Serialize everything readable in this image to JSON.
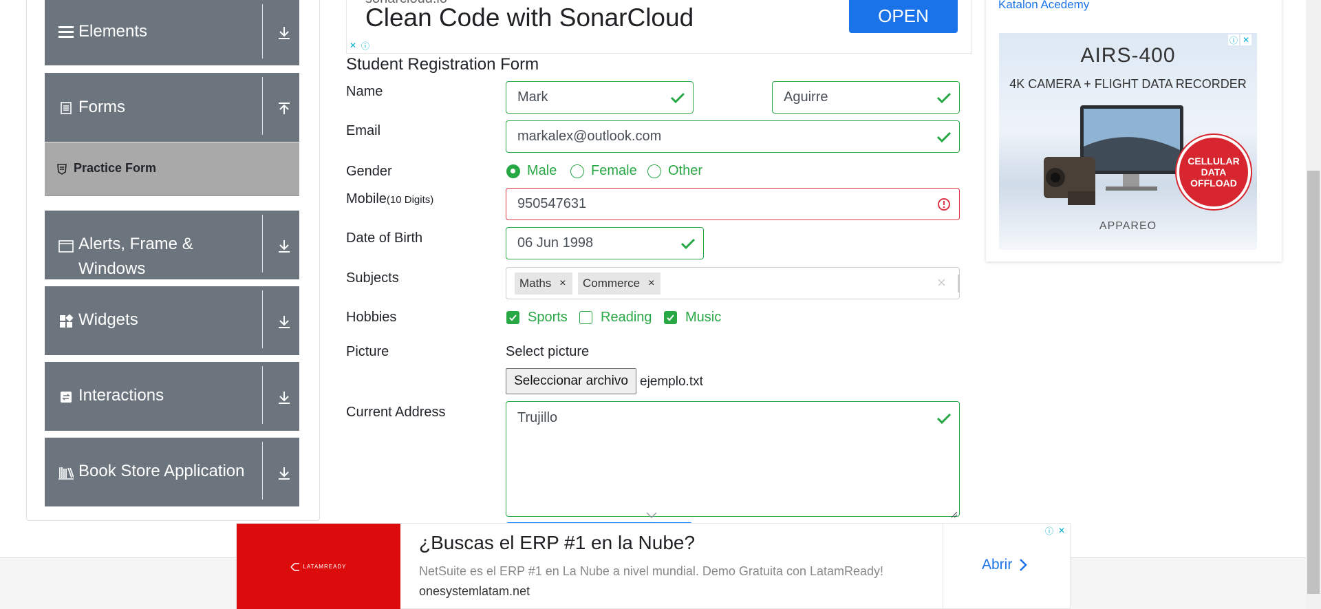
{
  "sidebar": {
    "groups": [
      {
        "label": "Elements",
        "icon": "hamburger-icon",
        "arrow": "download-arrow-icon"
      },
      {
        "label": "Forms",
        "icon": "document-icon",
        "arrow": "upload-arrow-icon"
      },
      {
        "label": "Alerts, Frame &",
        "label2": "Windows",
        "icon": "window-icon",
        "arrow": "download-arrow-icon"
      },
      {
        "label": "Widgets",
        "icon": "widgets-icon",
        "arrow": "download-arrow-icon"
      },
      {
        "label": "Interactions",
        "icon": "interactions-icon",
        "arrow": "download-arrow-icon"
      },
      {
        "label": "Book Store Application",
        "icon": "books-icon",
        "arrow": "download-arrow-icon"
      }
    ],
    "active_item": {
      "label": "Practice Form",
      "icon": "shield-icon"
    }
  },
  "top_ad": {
    "domain": "sonarcloud.io",
    "headline": "Clean Code with SonarCloud",
    "cta": "OPEN"
  },
  "form": {
    "title": "Student Registration Form",
    "name_label": "Name",
    "first_name": "Mark",
    "last_name": "Aguirre",
    "email_label": "Email",
    "email": "markalex@outlook.com",
    "gender_label": "Gender",
    "gender_options": [
      "Male",
      "Female",
      "Other"
    ],
    "gender_selected": "Male",
    "mobile_label": "Mobile",
    "mobile_hint": "(10 Digits)",
    "mobile": "950547631",
    "dob_label": "Date of Birth",
    "dob": "06 Jun 1998",
    "subjects_label": "Subjects",
    "subjects": [
      "Maths",
      "Commerce"
    ],
    "chip_remove": "×",
    "subjects_clear": "×",
    "hobbies_label": "Hobbies",
    "hobbies": [
      {
        "label": "Sports",
        "checked": true
      },
      {
        "label": "Reading",
        "checked": false
      },
      {
        "label": "Music",
        "checked": true
      }
    ],
    "picture_label": "Picture",
    "picture_prompt": "Select picture",
    "file_button": "Seleccionar archivo",
    "file_name": "ejemplo.txt",
    "address_label": "Current Address",
    "address": "Trujillo"
  },
  "right_ad": {
    "link_text": "Katalon Acedemy",
    "headline": "AIRS-400",
    "subheadline": "4K CAMERA + FLIGHT DATA RECORDER",
    "badge": "CELLULAR DATA OFFLOAD",
    "brand": "APPAREO"
  },
  "bottom_ad": {
    "logo": "LATAMREADY",
    "headline": "¿Buscas el ERP #1 en la Nube?",
    "description": "NetSuite es el ERP #1 en La Nube a nivel mundial. Demo Gratuita con LatamReady!",
    "domain": "onesystemlatam.net",
    "cta": "Abrir"
  },
  "colors": {
    "sidebar_bg": "#6c757d",
    "sidebar_active_bg": "#a9a9a9",
    "valid_green": "#28a745",
    "invalid_red": "#dc3545",
    "ad_blue": "#1a73e8",
    "latam_red": "#dc0c0c"
  }
}
